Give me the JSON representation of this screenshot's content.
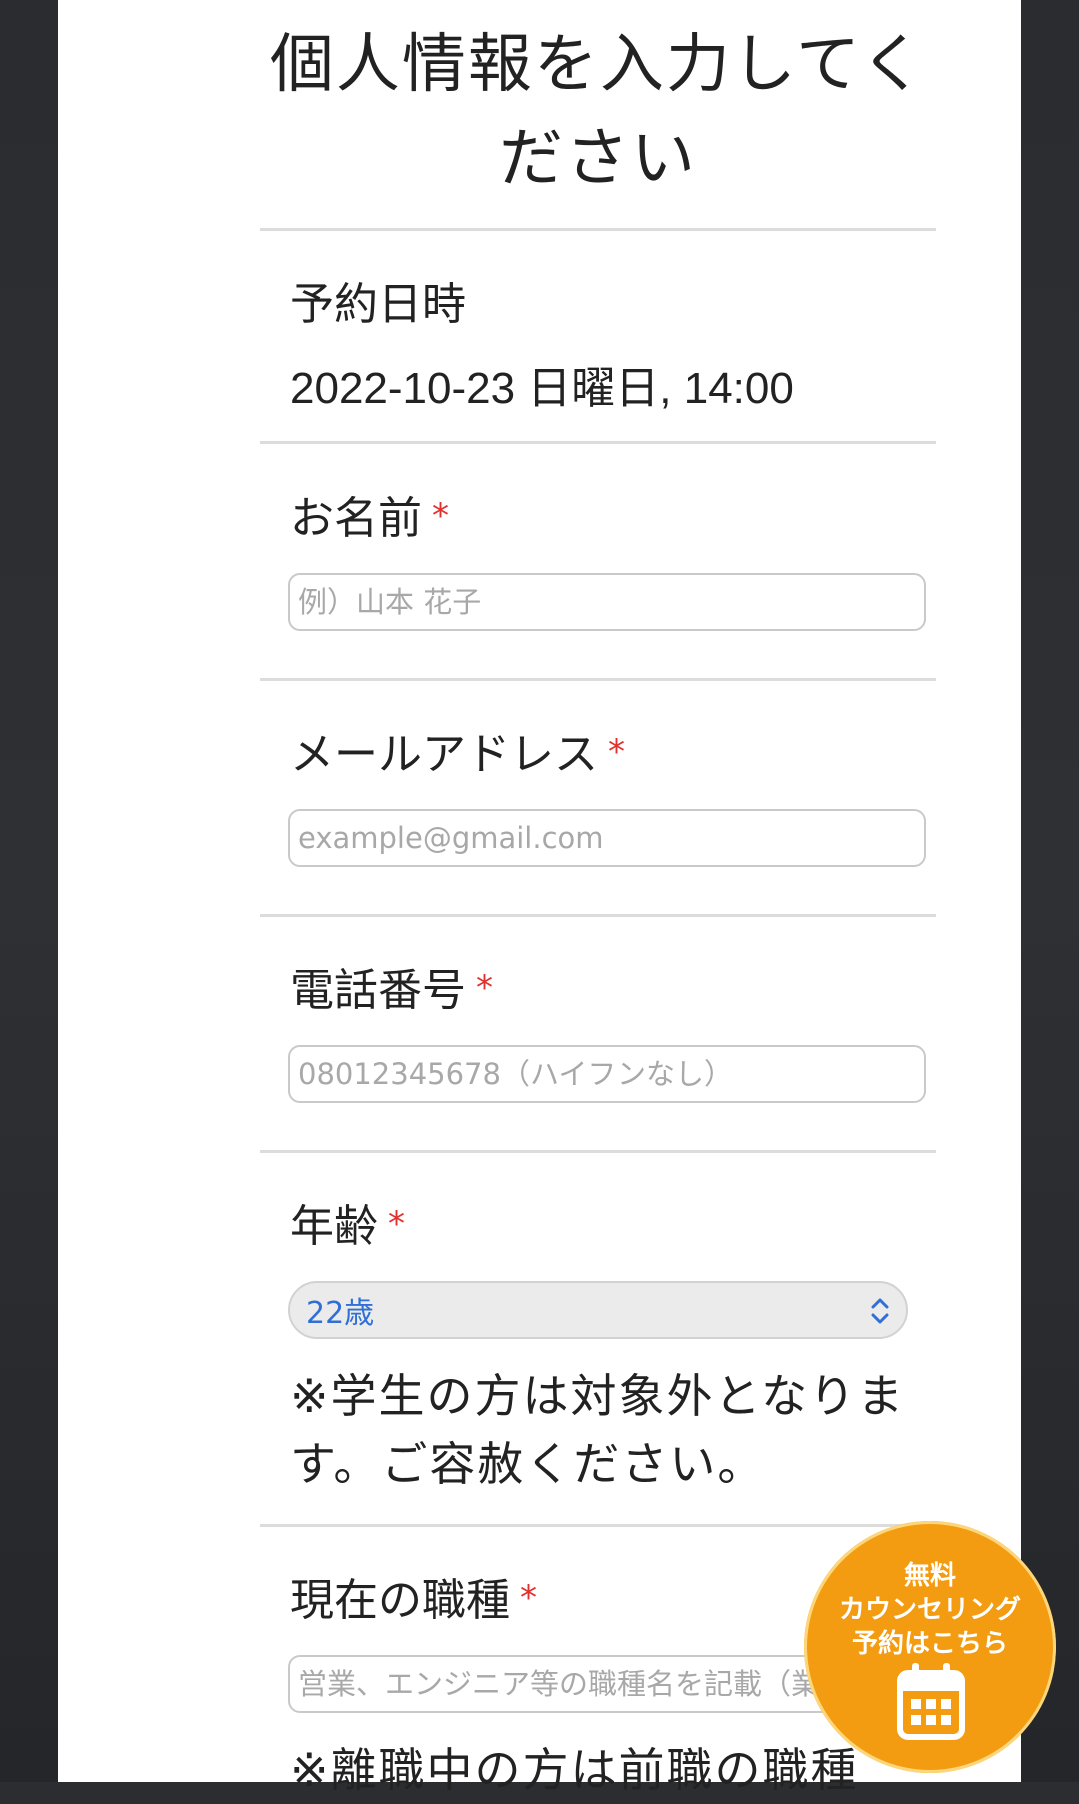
{
  "form": {
    "title_line1": "個人情報を入力してく",
    "title_line2": "ださい",
    "reservation": {
      "label": "予約日時",
      "value": "2022-10-23 日曜日, 14:00"
    },
    "name": {
      "label": "お名前",
      "required_mark": "*",
      "placeholder": "例）山本 花子"
    },
    "email": {
      "label": "メールアドレス",
      "required_mark": "*",
      "placeholder": "example@gmail.com"
    },
    "phone": {
      "label": "電話番号",
      "required_mark": "*",
      "placeholder": "08012345678（ハイフンなし）"
    },
    "age": {
      "label": "年齢",
      "required_mark": "*",
      "selected": "22歳",
      "note_line1": "※学生の方は対象外となりま",
      "note_line2": "す。ご容赦ください。"
    },
    "occupation": {
      "label": "現在の職種",
      "required_mark": "*",
      "placeholder": "営業、エンジニア等の職種名を記載（業務内",
      "note_line1": "※離職中の方は前職の職種"
    }
  },
  "cta": {
    "line1": "無料",
    "line2": "カウンセリング",
    "line3": "予約はこちら",
    "icon": "calendar-icon",
    "color": "#f39c12"
  },
  "colors": {
    "required": "#e0312f",
    "select_value": "#2f6fd6"
  }
}
